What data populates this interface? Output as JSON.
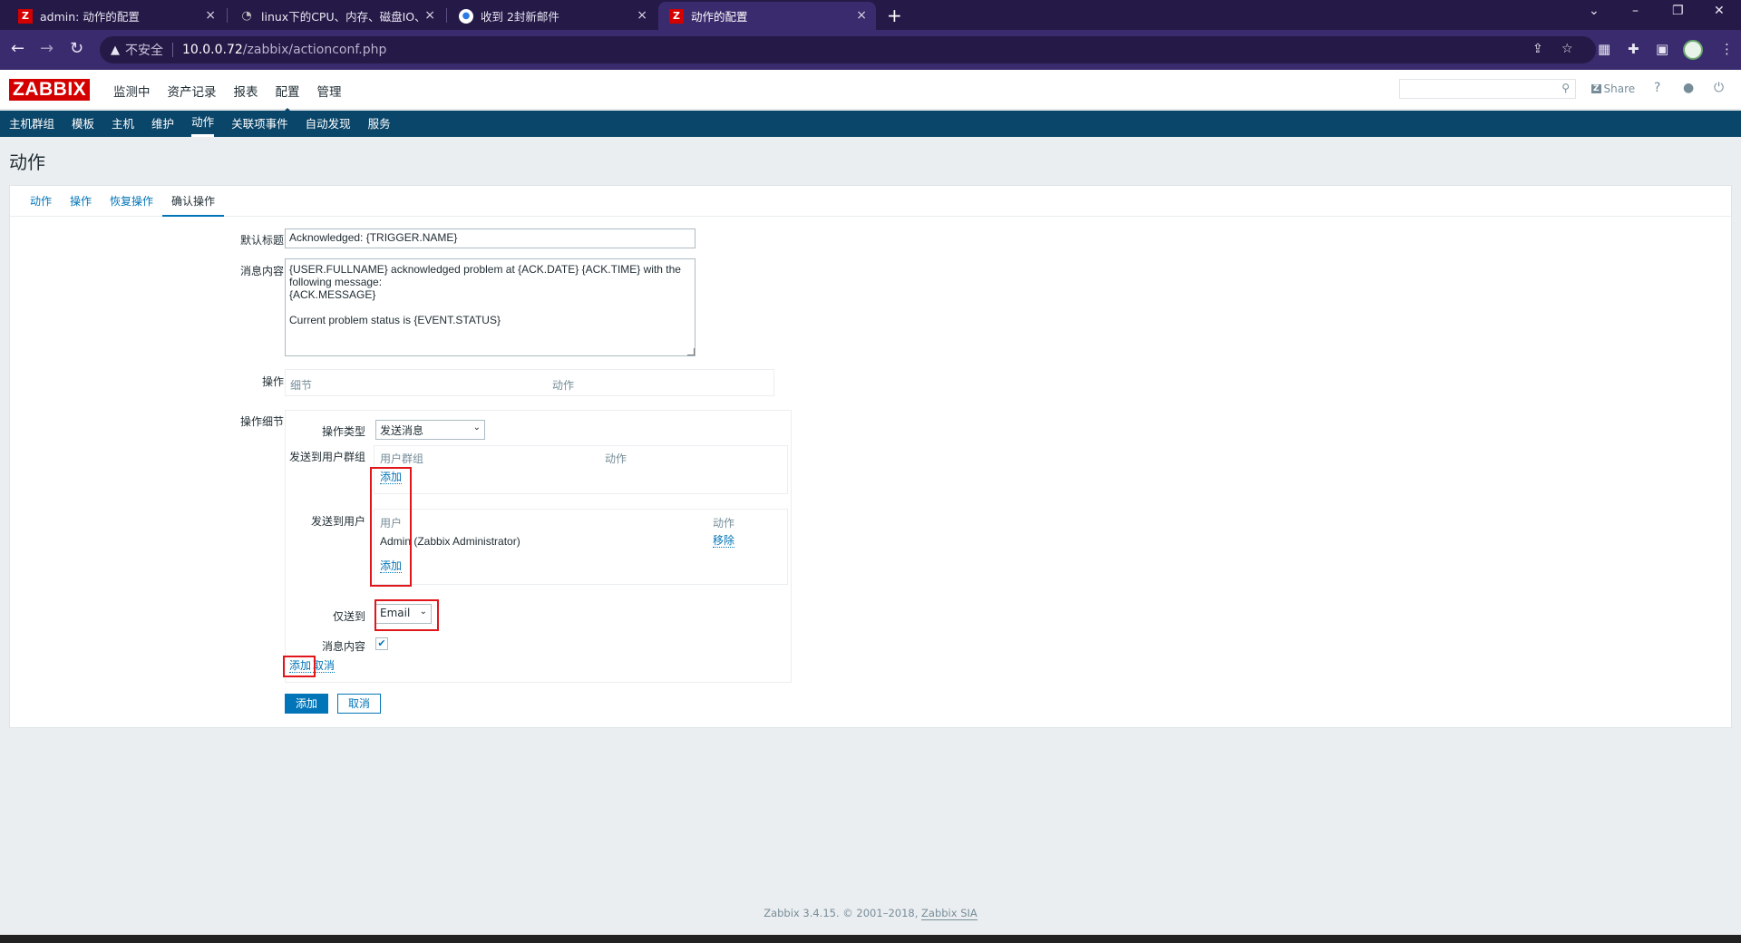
{
  "browser": {
    "tabs": [
      {
        "title": "admin: 动作的配置",
        "icon": "zabbix-favicon",
        "active": false
      },
      {
        "title": "linux下的CPU、内存、磁盘IO、",
        "icon": "github-favicon",
        "active": false
      },
      {
        "title": "收到 2封新邮件",
        "icon": "mail-favicon",
        "active": false
      },
      {
        "title": "动作的配置",
        "icon": "zabbix-favicon",
        "active": true
      }
    ],
    "close_glyph": "×",
    "newtab_glyph": "+",
    "insecure_label": "不安全",
    "url_host": "10.0.0.72",
    "url_path": "/zabbix/actionconf.php"
  },
  "header": {
    "logo": "ZABBIX",
    "menu": [
      "监测中",
      "资产记录",
      "报表",
      "配置",
      "管理"
    ],
    "selected_menu": "配置",
    "share_label": "Share",
    "help_label": "?"
  },
  "submenu": {
    "items": [
      "主机群组",
      "模板",
      "主机",
      "维护",
      "动作",
      "关联项事件",
      "自动发现",
      "服务"
    ],
    "selected": "动作"
  },
  "page": {
    "title": "动作"
  },
  "form": {
    "tabs": [
      "动作",
      "操作",
      "恢复操作",
      "确认操作"
    ],
    "selected_tab": "确认操作",
    "default_subject_label": "默认标题",
    "default_subject_value": "Acknowledged: {TRIGGER.NAME}",
    "message_label": "消息内容",
    "message_value": "{USER.FULLNAME} acknowledged problem at {ACK.DATE} {ACK.TIME} with the\nfollowing message:\n{ACK.MESSAGE}\n\nCurrent problem status is {EVENT.STATUS}",
    "operations_label": "操作",
    "operations_columns": [
      "细节",
      "动作"
    ],
    "op_details_label": "操作细节",
    "op_type_label": "操作类型",
    "op_type_value": "发送消息",
    "send_to_groups_label": "发送到用户群组",
    "groups_columns": [
      "用户群组",
      "动作"
    ],
    "groups_add": "添加",
    "send_to_users_label": "发送到用户",
    "users_columns": [
      "用户",
      "动作"
    ],
    "users": [
      {
        "name": "Admin (Zabbix Administrator)",
        "action": "移除"
      }
    ],
    "users_add": "添加",
    "send_only_to_label": "仅送到",
    "send_only_to_value": "Email",
    "default_message_label": "消息内容",
    "default_message_checked": true,
    "detail_add": "添加",
    "detail_cancel": "取消",
    "submit_add": "添加",
    "submit_cancel": "取消"
  },
  "footer": {
    "text": "Zabbix 3.4.15. © 2001–2018, ",
    "link": "Zabbix SIA"
  }
}
